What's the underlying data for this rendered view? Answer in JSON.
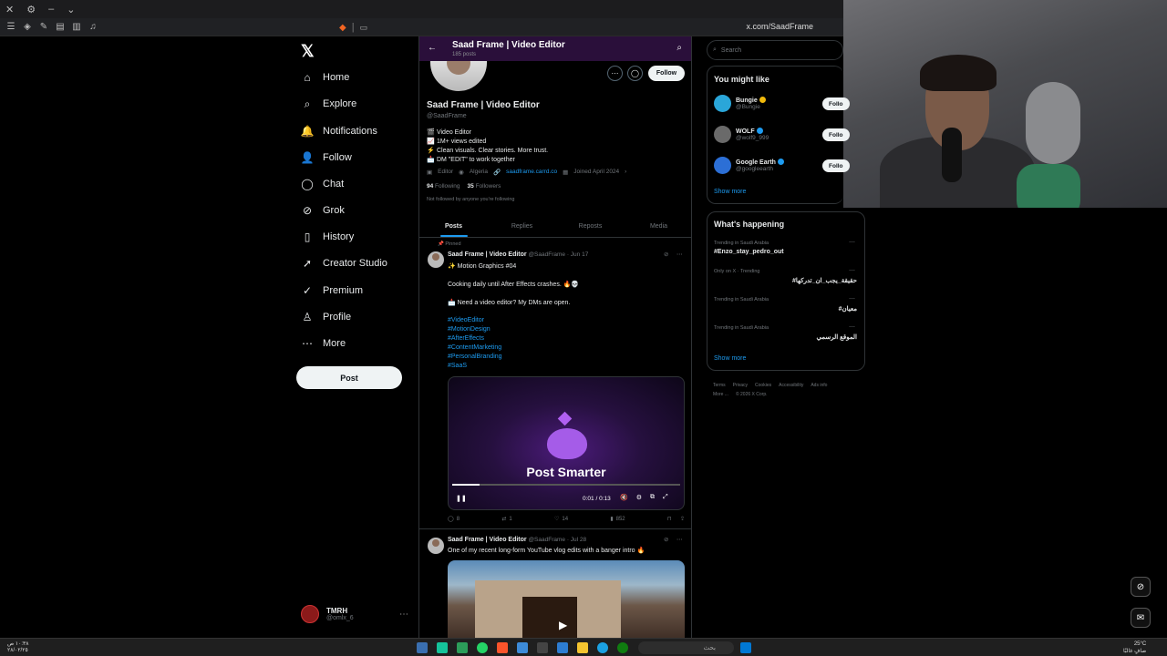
{
  "browser": {
    "url": "x.com/SaadFrame"
  },
  "nav": {
    "logo": "𝕏",
    "items": [
      {
        "label": "Home",
        "icon": "⌂"
      },
      {
        "label": "Explore",
        "icon": "⌕"
      },
      {
        "label": "Notifications",
        "icon": "🔔"
      },
      {
        "label": "Follow",
        "icon": "👤"
      },
      {
        "label": "Chat",
        "icon": "◯"
      },
      {
        "label": "Grok",
        "icon": "⊘"
      },
      {
        "label": "History",
        "icon": "▯"
      },
      {
        "label": "Creator Studio",
        "icon": "➚"
      },
      {
        "label": "Premium",
        "icon": "✓"
      },
      {
        "label": "Profile",
        "icon": "♙"
      },
      {
        "label": "More",
        "icon": "⋯"
      }
    ],
    "post_button": "Post",
    "account_name": "TMRH",
    "account_handle": "@omlx_6"
  },
  "profile": {
    "header_title": "Saad Frame | Video Editor",
    "post_count": "185 posts",
    "name": "Saad Frame | Video Editor",
    "handle": "@SaadFrame",
    "follow_button": "Follow",
    "bio": [
      {
        "emoji": "🎬",
        "text": "Video Editor"
      },
      {
        "emoji": "📈",
        "text": "1M+ views edited"
      },
      {
        "emoji": "⚡",
        "text": "Clean visuals. Clear stories. More trust."
      },
      {
        "emoji": "📩",
        "text": "DM \"EDIT\" to work together"
      }
    ],
    "meta_category": "Editor",
    "meta_location": "Algeria",
    "meta_link": "saadframe.carrd.co",
    "meta_joined": "Joined April 2024",
    "following_count": "94",
    "following_label": "Following",
    "followers_count": "35",
    "followers_label": "Followers",
    "not_followed": "Not followed by anyone you're following",
    "tabs": [
      "Posts",
      "Replies",
      "Reposts",
      "Media"
    ]
  },
  "post1": {
    "pinned": "Pinned",
    "name": "Saad Frame | Video Editor",
    "handle": "@SaadFrame",
    "date": "· Jun 17",
    "line1": "✨ Motion Graphics #04",
    "line2": "Cooking daily until After Effects crashes. 🔥💀",
    "line3": "📩 Need a video editor? My DMs are open.",
    "hashtags": [
      "#VideoEditor",
      "#MotionDesign",
      "#AfterEffects",
      "#ContentMarketing",
      "#PersonalBranding",
      "#SaaS"
    ],
    "video_title": "Post Smarter",
    "video_time": "0:01 / 0:13",
    "replies": "8",
    "reposts": "1",
    "likes": "14",
    "views": "852",
    "progress": 0.12
  },
  "post2": {
    "name": "Saad Frame | Video Editor",
    "handle": "@SaadFrame",
    "date": "· Jul 28",
    "text": "One of my recent long-form YouTube vlog edits with a banger intro 🔥"
  },
  "right": {
    "search_placeholder": "Search",
    "you_might_like": "You might like",
    "suggestions": [
      {
        "name": "Bungie",
        "handle": "@Bungie",
        "color": "#2aa6d9",
        "badge": "#f0b90b"
      },
      {
        "name": "WOLF",
        "handle": "@wolf9_999",
        "color": "#6a6a6a",
        "badge": "#1d9bf0"
      },
      {
        "name": "Google Earth",
        "handle": "@googleearth",
        "color": "#2c6fd6",
        "badge": "#1d9bf0"
      }
    ],
    "follow_label": "Follo",
    "show_more": "Show more",
    "whats_happening": "What's happening",
    "trends": [
      {
        "context": "Trending in Saudi Arabia",
        "tag": "#Enzo_stay_pedro_out"
      },
      {
        "context": "Only on X · Trending",
        "tag": "#حقيقة_يجب_ان_تدركها"
      },
      {
        "context": "Trending in Saudi Arabia",
        "tag": "#معيان"
      },
      {
        "context": "Trending in Saudi Arabia",
        "tag": "الموقع الرسمي"
      }
    ],
    "show_more2": "Show more",
    "footer": [
      "Terms",
      "Privacy",
      "Cookies",
      "Accessibility",
      "Ads info",
      "More ...",
      "© 2026 X Corp."
    ]
  },
  "taskbar": {
    "search": "بحث",
    "temp": "25°C",
    "weather": "صافٍ غالبًا",
    "time": "١٠:٣٨ ص",
    "date": "٢٨/٠٢/٢٥"
  }
}
